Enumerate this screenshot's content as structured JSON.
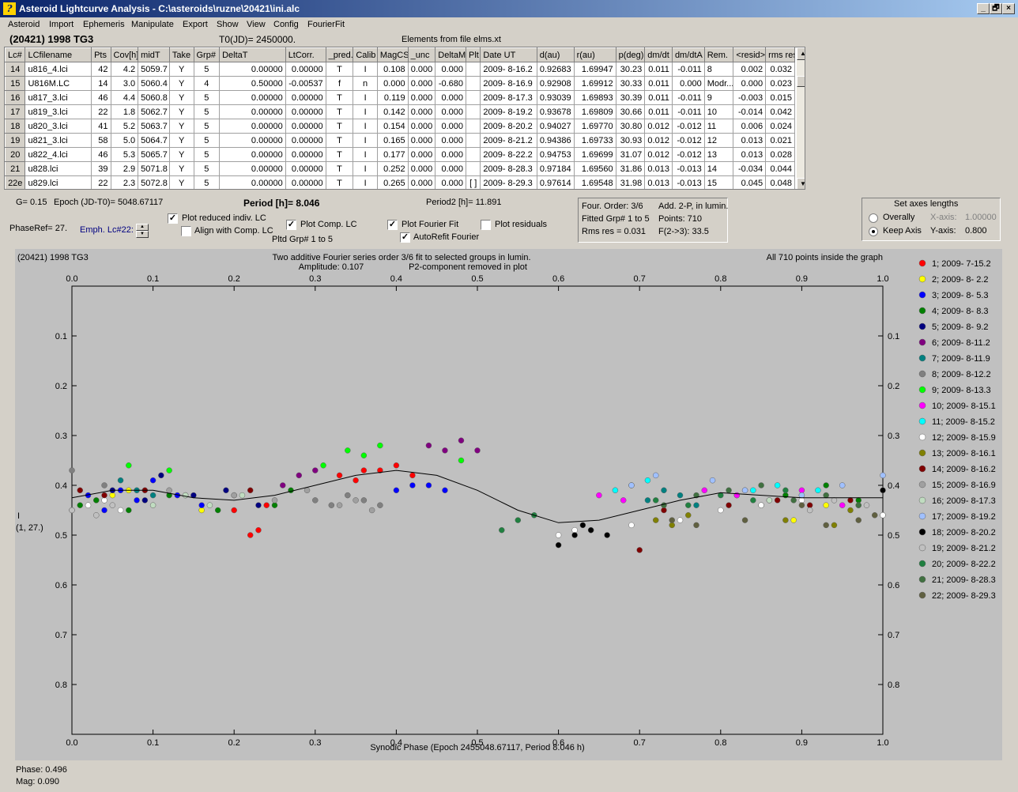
{
  "window": {
    "title": "Asteroid Lightcurve Analysis - C:\\asteroids\\ruzne\\20421\\ini.alc",
    "buttons": [
      "_",
      "🗗",
      "×"
    ]
  },
  "menu": [
    "Asteroid",
    "Import",
    "Ephemeris",
    "Manipulate",
    "Export",
    "Show",
    "View",
    "Config",
    "FourierFit"
  ],
  "info": {
    "object": "(20421) 1998 TG3",
    "t0": "T0(JD)= 2450000.",
    "elements": "Elements from file elms.xt"
  },
  "table": {
    "headers": [
      "Lc#",
      "LCfilename",
      "Pts",
      "Cov[h]",
      "midT",
      "Take",
      "Grp#",
      "DeltaT",
      "LtCorr.",
      "_pred.",
      "Calib",
      "MagCS",
      "_unc",
      "DeltaM",
      "Plt",
      "Date UT",
      "d(au)",
      "r(au)",
      "p(deg)",
      "dm/dt",
      "dm/dtA",
      "Rem.",
      "<resid>",
      "rms res"
    ],
    "rows": [
      [
        "14",
        "u816_4.lci",
        "42",
        "4.2",
        "5059.7",
        "Y",
        "5",
        "0.00000",
        "0.00000",
        "T",
        "I",
        "0.108",
        "0.000",
        "0.000",
        "",
        "2009- 8-16.2",
        "0.92683",
        "1.69947",
        "30.23",
        "0.011",
        "-0.011",
        "8",
        "0.002",
        "0.032"
      ],
      [
        "15",
        "U816M.LC",
        "14",
        "3.0",
        "5060.4",
        "Y",
        "4",
        "0.50000",
        "-0.00537",
        "f",
        "n",
        "0.000",
        "0.000",
        "-0.680",
        "",
        "2009- 8-16.9",
        "0.92908",
        "1.69912",
        "30.33",
        "0.011",
        "0.000",
        "Modr...",
        "0.000",
        "0.023"
      ],
      [
        "16",
        "u817_3.lci",
        "46",
        "4.4",
        "5060.8",
        "Y",
        "5",
        "0.00000",
        "0.00000",
        "T",
        "I",
        "0.119",
        "0.000",
        "0.000",
        "",
        "2009- 8-17.3",
        "0.93039",
        "1.69893",
        "30.39",
        "0.011",
        "-0.011",
        "9",
        "-0.003",
        "0.015"
      ],
      [
        "17",
        "u819_3.lci",
        "22",
        "1.8",
        "5062.7",
        "Y",
        "5",
        "0.00000",
        "0.00000",
        "T",
        "I",
        "0.142",
        "0.000",
        "0.000",
        "",
        "2009- 8-19.2",
        "0.93678",
        "1.69809",
        "30.66",
        "0.011",
        "-0.011",
        "10",
        "-0.014",
        "0.042"
      ],
      [
        "18",
        "u820_3.lci",
        "41",
        "5.2",
        "5063.7",
        "Y",
        "5",
        "0.00000",
        "0.00000",
        "T",
        "I",
        "0.154",
        "0.000",
        "0.000",
        "",
        "2009- 8-20.2",
        "0.94027",
        "1.69770",
        "30.80",
        "0.012",
        "-0.012",
        "11",
        "0.006",
        "0.024"
      ],
      [
        "19",
        "u821_3.lci",
        "58",
        "5.0",
        "5064.7",
        "Y",
        "5",
        "0.00000",
        "0.00000",
        "T",
        "I",
        "0.165",
        "0.000",
        "0.000",
        "",
        "2009- 8-21.2",
        "0.94386",
        "1.69733",
        "30.93",
        "0.012",
        "-0.012",
        "12",
        "0.013",
        "0.021"
      ],
      [
        "20",
        "u822_4.lci",
        "46",
        "5.3",
        "5065.7",
        "Y",
        "5",
        "0.00000",
        "0.00000",
        "T",
        "I",
        "0.177",
        "0.000",
        "0.000",
        "",
        "2009- 8-22.2",
        "0.94753",
        "1.69699",
        "31.07",
        "0.012",
        "-0.012",
        "13",
        "0.013",
        "0.028"
      ],
      [
        "21",
        "u828.lci",
        "39",
        "2.9",
        "5071.8",
        "Y",
        "5",
        "0.00000",
        "0.00000",
        "T",
        "I",
        "0.252",
        "0.000",
        "0.000",
        "",
        "2009- 8-28.3",
        "0.97184",
        "1.69560",
        "31.86",
        "0.013",
        "-0.013",
        "14",
        "-0.034",
        "0.044"
      ],
      [
        "22e",
        "u829.lci",
        "22",
        "2.3",
        "5072.8",
        "Y",
        "5",
        "0.00000",
        "0.00000",
        "T",
        "I",
        "0.265",
        "0.000",
        "0.000",
        "[ ]",
        "2009- 8-29.3",
        "0.97614",
        "1.69548",
        "31.98",
        "0.013",
        "-0.013",
        "15",
        "0.045",
        "0.048"
      ]
    ]
  },
  "params": {
    "g": "G= 0.15",
    "epoch": "Epoch (JD-T0)= 5048.67117",
    "period": "Period [h]= 8.046",
    "period2": "Period2 [h]= 11.891",
    "phaseref": "PhaseRef= 27.",
    "emph": "Emph. Lc#22:",
    "pltdgrp": "Pltd Grp#  1   to   5"
  },
  "checks": {
    "plot_reduced": "Plot reduced indiv. LC",
    "align": "Align with Comp. LC",
    "plot_comp": "Plot Comp. LC",
    "plot_fourier": "Plot Fourier Fit",
    "autorefit": "AutoRefit Fourier",
    "plot_resid": "Plot residuals"
  },
  "fourier": {
    "order": "Four. Order:  3/6",
    "add": "Add. 2-P, in lumin.",
    "fitted": "Fitted Grp# 1 to 5",
    "points": "Points: 710",
    "rms": "Rms res     = 0.031",
    "f23": "F(2->3):  33.5"
  },
  "axes": {
    "title": "Set axes lengths",
    "overall": "Overally",
    "keep": "Keep Axis",
    "xaxis": "X-axis:",
    "xval": "1.00000",
    "yaxis": "Y-axis:",
    "yval": "0.800"
  },
  "graph": {
    "object": "(20421) 1998 TG3",
    "desc1": "Two additive Fourier series order 3/6 fit to selected groups in lumin.",
    "desc2": "Amplitude: 0.107",
    "desc3": "P2-component removed in plot",
    "inside": "All 710 points inside the graph",
    "ylabel1": "I",
    "ylabel2": "(1, 27.)",
    "xlabel": "Synodic Phase (Epoch 2455048.67117, Period 8.046 h)"
  },
  "chart_data": {
    "type": "scatter",
    "xlim": [
      0,
      1
    ],
    "ylim": [
      0,
      0.9
    ],
    "y_inverted": true,
    "xticks": [
      "0.0",
      "0.1",
      "0.2",
      "0.3",
      "0.4",
      "0.5",
      "0.6",
      "0.7",
      "0.8",
      "0.9",
      "1.0"
    ],
    "yticks": [
      "0.1",
      "0.2",
      "0.3",
      "0.4",
      "0.5",
      "0.6",
      "0.7",
      "0.8"
    ],
    "fit": {
      "x": [
        0,
        0.05,
        0.1,
        0.15,
        0.2,
        0.25,
        0.3,
        0.35,
        0.4,
        0.45,
        0.5,
        0.55,
        0.6,
        0.65,
        0.7,
        0.75,
        0.8,
        0.85,
        0.9,
        0.95,
        1.0
      ],
      "y": [
        0.425,
        0.41,
        0.41,
        0.425,
        0.43,
        0.42,
        0.4,
        0.38,
        0.37,
        0.38,
        0.41,
        0.45,
        0.475,
        0.47,
        0.45,
        0.43,
        0.415,
        0.42,
        0.425,
        0.425,
        0.425
      ]
    },
    "series": [
      {
        "name": "1; 2009- 7-15.2",
        "color": "#ff0000",
        "x": [
          0.2,
          0.22,
          0.23,
          0.24,
          0.33,
          0.35,
          0.36,
          0.38,
          0.4,
          0.42
        ],
        "y": [
          0.45,
          0.5,
          0.49,
          0.44,
          0.38,
          0.39,
          0.37,
          0.37,
          0.36,
          0.38
        ]
      },
      {
        "name": "2; 2009- 8- 2.2",
        "color": "#ffff00",
        "x": [
          0.03,
          0.05,
          0.07,
          0.16,
          0.82,
          0.89,
          0.93
        ],
        "y": [
          0.43,
          0.42,
          0.41,
          0.45,
          0.42,
          0.47,
          0.44
        ]
      },
      {
        "name": "3; 2009- 8- 5.3",
        "color": "#0000ff",
        "x": [
          0.02,
          0.04,
          0.06,
          0.08,
          0.1,
          0.13,
          0.16,
          0.4,
          0.42,
          0.44,
          0.46
        ],
        "y": [
          0.42,
          0.45,
          0.41,
          0.43,
          0.39,
          0.42,
          0.44,
          0.41,
          0.4,
          0.4,
          0.41
        ]
      },
      {
        "name": "4; 2009- 8- 8.3",
        "color": "#008000",
        "x": [
          0.01,
          0.03,
          0.07,
          0.12,
          0.18,
          0.25,
          0.27,
          0.85,
          0.88,
          0.93,
          0.97,
          1.0
        ],
        "y": [
          0.44,
          0.43,
          0.45,
          0.42,
          0.45,
          0.44,
          0.41,
          0.44,
          0.42,
          0.4,
          0.43,
          0.46
        ]
      },
      {
        "name": "5; 2009- 8- 9.2",
        "color": "#000080",
        "x": [
          0.05,
          0.09,
          0.11,
          0.15,
          0.19,
          0.23
        ],
        "y": [
          0.41,
          0.43,
          0.38,
          0.42,
          0.41,
          0.44
        ]
      },
      {
        "name": "6; 2009- 8-11.2",
        "color": "#800080",
        "x": [
          0.26,
          0.28,
          0.3,
          0.44,
          0.46,
          0.48,
          0.5
        ],
        "y": [
          0.4,
          0.38,
          0.37,
          0.32,
          0.33,
          0.31,
          0.33
        ]
      },
      {
        "name": "7; 2009- 8-11.9",
        "color": "#008080",
        "x": [
          0.06,
          0.08,
          0.1,
          0.71,
          0.73,
          0.75,
          0.77
        ],
        "y": [
          0.39,
          0.41,
          0.42,
          0.43,
          0.41,
          0.42,
          0.44
        ]
      },
      {
        "name": "8; 2009- 8-12.2",
        "color": "#808080",
        "x": [
          0.0,
          0.04,
          0.14,
          0.3,
          0.32,
          0.34,
          0.36,
          0.38
        ],
        "y": [
          0.37,
          0.4,
          0.42,
          0.43,
          0.44,
          0.42,
          0.43,
          0.44
        ]
      },
      {
        "name": "9; 2009- 8-13.3",
        "color": "#00ff00",
        "x": [
          0.07,
          0.12,
          0.31,
          0.34,
          0.36,
          0.38,
          0.48
        ],
        "y": [
          0.36,
          0.37,
          0.36,
          0.33,
          0.34,
          0.32,
          0.35
        ]
      },
      {
        "name": "10; 2009- 8-15.1",
        "color": "#ff00ff",
        "x": [
          0.65,
          0.68,
          0.78,
          0.82,
          0.86,
          0.9,
          0.95
        ],
        "y": [
          0.42,
          0.43,
          0.41,
          0.42,
          0.43,
          0.41,
          0.44
        ]
      },
      {
        "name": "11; 2009- 8-15.2",
        "color": "#00ffff",
        "x": [
          0.67,
          0.69,
          0.71,
          0.84,
          0.87,
          0.9,
          0.92
        ],
        "y": [
          0.41,
          0.4,
          0.39,
          0.41,
          0.4,
          0.42,
          0.41
        ]
      },
      {
        "name": "12; 2009- 8-15.9",
        "color": "#ffffff",
        "x": [
          0.0,
          0.02,
          0.04,
          0.06,
          0.6,
          0.62,
          0.64,
          0.69,
          0.75,
          0.8,
          0.85,
          0.9,
          0.97,
          1.0
        ],
        "y": [
          0.45,
          0.44,
          0.43,
          0.45,
          0.5,
          0.49,
          0.49,
          0.48,
          0.47,
          0.45,
          0.44,
          0.43,
          0.44,
          0.46
        ]
      },
      {
        "name": "13; 2009- 8-16.1",
        "color": "#808000",
        "x": [
          0.72,
          0.74,
          0.76,
          0.88,
          0.94,
          0.96
        ],
        "y": [
          0.47,
          0.48,
          0.46,
          0.47,
          0.48,
          0.45
        ]
      },
      {
        "name": "14; 2009- 8-16.2",
        "color": "#800000",
        "x": [
          0.01,
          0.04,
          0.09,
          0.2,
          0.22,
          0.7,
          0.73,
          0.81,
          0.87,
          0.91,
          0.96
        ],
        "y": [
          0.41,
          0.42,
          0.41,
          0.42,
          0.41,
          0.53,
          0.45,
          0.44,
          0.43,
          0.44,
          0.43
        ]
      },
      {
        "name": "15; 2009- 8-16.9",
        "color": "#a0a0a0",
        "x": [
          0.12,
          0.2,
          0.25,
          0.29,
          0.33,
          0.35,
          0.37
        ],
        "y": [
          0.41,
          0.42,
          0.43,
          0.41,
          0.44,
          0.43,
          0.45
        ]
      },
      {
        "name": "16; 2009- 8-17.3",
        "color": "#c0dcc0",
        "x": [
          0.1,
          0.14,
          0.17,
          0.21,
          0.83,
          0.86
        ],
        "y": [
          0.44,
          0.42,
          0.44,
          0.42,
          0.41,
          0.43
        ]
      },
      {
        "name": "17; 2009- 8-19.2",
        "color": "#a0c0ff",
        "x": [
          0.69,
          0.72,
          0.79,
          0.83,
          0.9,
          0.95,
          1.0
        ],
        "y": [
          0.4,
          0.38,
          0.39,
          0.41,
          0.42,
          0.4,
          0.38
        ]
      },
      {
        "name": "18; 2009- 8-20.2",
        "color": "#000000",
        "x": [
          0.6,
          0.62,
          0.63,
          0.64,
          0.66,
          1.0
        ],
        "y": [
          0.52,
          0.5,
          0.48,
          0.49,
          0.5,
          0.41
        ]
      },
      {
        "name": "19; 2009- 8-21.2",
        "color": "#c0c0c0",
        "x": [
          0.0,
          0.03,
          0.05,
          0.91,
          0.94,
          0.98
        ],
        "y": [
          0.45,
          0.46,
          0.44,
          0.45,
          0.43,
          0.44
        ]
      },
      {
        "name": "20; 2009- 8-22.2",
        "color": "#208040",
        "x": [
          0.53,
          0.55,
          0.57,
          0.72,
          0.76,
          0.8,
          0.84,
          0.88
        ],
        "y": [
          0.49,
          0.47,
          0.46,
          0.43,
          0.44,
          0.42,
          0.43,
          0.41
        ]
      },
      {
        "name": "21; 2009- 8-28.3",
        "color": "#407040",
        "x": [
          0.73,
          0.77,
          0.81,
          0.85,
          0.89,
          0.93,
          0.97
        ],
        "y": [
          0.44,
          0.42,
          0.41,
          0.4,
          0.43,
          0.42,
          0.44
        ]
      },
      {
        "name": "22; 2009- 8-29.3",
        "color": "#606040",
        "x": [
          0.74,
          0.77,
          0.83,
          0.9,
          0.93,
          0.97,
          0.99
        ],
        "y": [
          0.47,
          0.48,
          0.47,
          0.44,
          0.48,
          0.47,
          0.46
        ]
      }
    ]
  },
  "status": {
    "phase": "Phase:  0.496",
    "mag": "Mag:   0.090"
  }
}
